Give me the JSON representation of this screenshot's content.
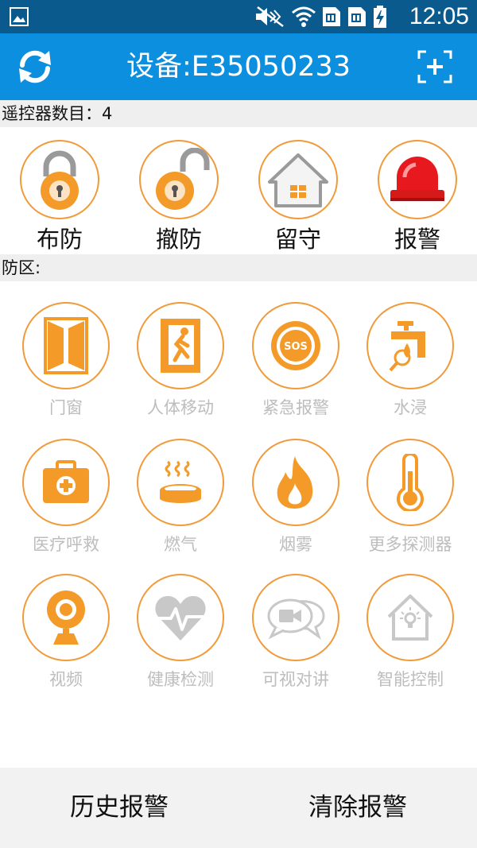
{
  "status_bar": {
    "time": "12:05",
    "icons": [
      "gallery-icon",
      "mute-icon",
      "wifi-icon",
      "sim1-icon",
      "sim2-icon",
      "battery-charging-icon"
    ]
  },
  "header": {
    "title": "设备:E35050233",
    "background_color": "#0d8fe0"
  },
  "remote_section": {
    "label": "遥控器数目：4",
    "items": [
      {
        "label": "布防",
        "icon": "locked-padlock-icon"
      },
      {
        "label": "撤防",
        "icon": "unlocked-padlock-icon"
      },
      {
        "label": "留守",
        "icon": "house-icon"
      },
      {
        "label": "报警",
        "icon": "siren-icon"
      }
    ]
  },
  "zone_section": {
    "label": "防区:",
    "items": [
      {
        "label": "门窗",
        "icon": "door-window-icon"
      },
      {
        "label": "人体移动",
        "icon": "running-man-icon"
      },
      {
        "label": "紧急报警",
        "icon": "sos-icon"
      },
      {
        "label": "水浸",
        "icon": "water-tap-icon"
      },
      {
        "label": "医疗呼救",
        "icon": "first-aid-kit-icon"
      },
      {
        "label": "燃气",
        "icon": "gas-stove-icon"
      },
      {
        "label": "烟雾",
        "icon": "fire-icon"
      },
      {
        "label": "更多探测器",
        "icon": "thermometer-icon"
      },
      {
        "label": "视频",
        "icon": "webcam-icon"
      },
      {
        "label": "健康检测",
        "icon": "heart-pulse-icon"
      },
      {
        "label": "可视对讲",
        "icon": "video-chat-icon"
      },
      {
        "label": "智能控制",
        "icon": "smart-home-icon"
      }
    ]
  },
  "footer": {
    "history_label": "历史报警",
    "clear_label": "清除报警"
  },
  "colors": {
    "accent_orange": "#f19a3a",
    "status_bar": "#0a5a8e",
    "disabled_text": "#bdbdbd"
  }
}
